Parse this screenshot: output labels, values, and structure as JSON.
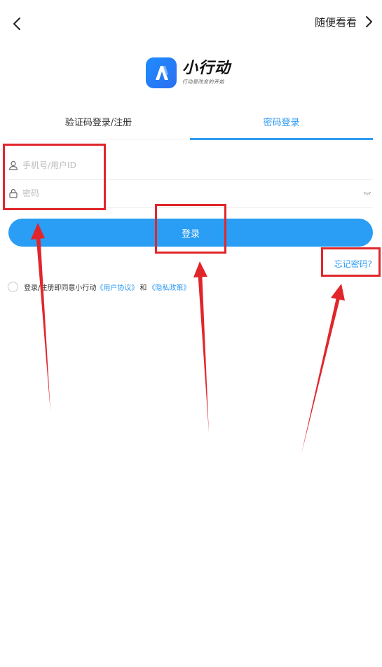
{
  "topbar": {
    "browse_label": "随便看看"
  },
  "logo": {
    "name": "小行动",
    "slogan": "行动是改变的开始"
  },
  "tabs": [
    {
      "label": "验证码登录/注册",
      "active": false
    },
    {
      "label": "密码登录",
      "active": true
    }
  ],
  "form": {
    "account_placeholder": "手机号/用户ID",
    "password_placeholder": "密码",
    "login_label": "登录",
    "forgot_label": "忘记密码?"
  },
  "agreement": {
    "prefix": "登录/注册即同意小行动",
    "user_agreement": "《用户协议》",
    "and": "和",
    "privacy_policy": "《隐私政策》"
  },
  "colors": {
    "accent": "#2a9df4",
    "annotation": "#e1262b"
  }
}
